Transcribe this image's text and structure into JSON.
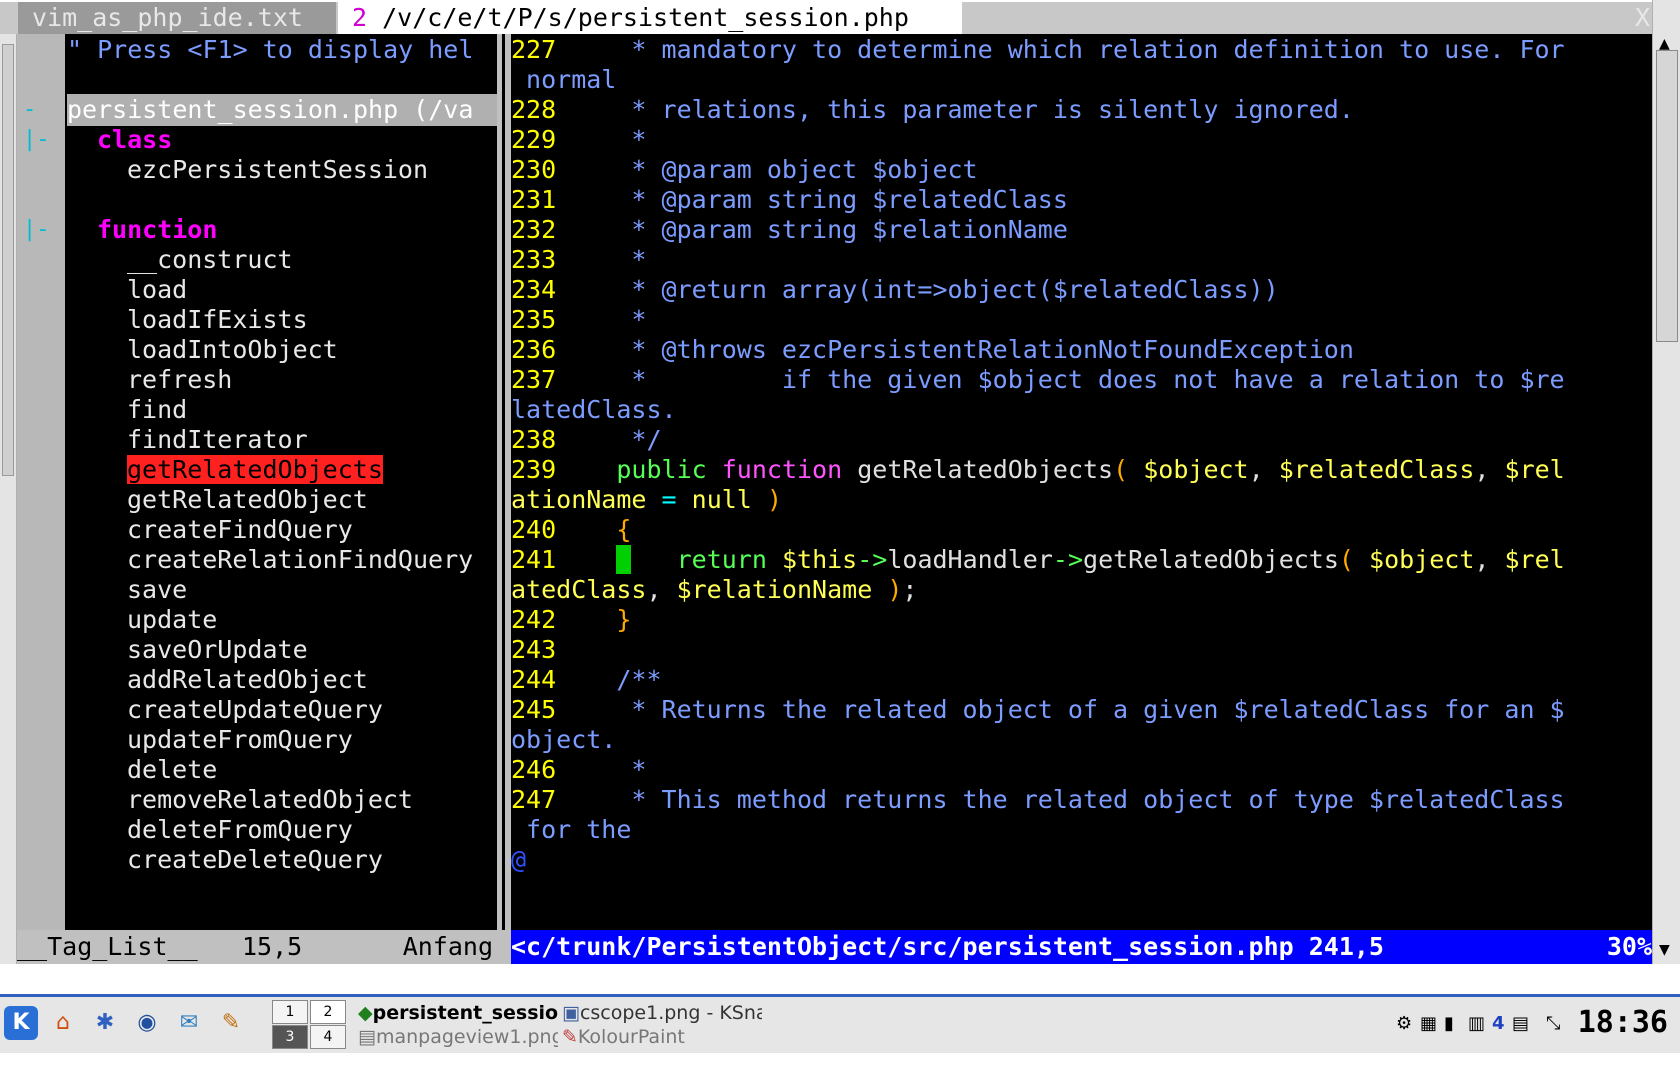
{
  "tabs": [
    {
      "label": "vim_as_php_ide.txt"
    },
    {
      "number": "2",
      "label": " /v/c/e/t/P/s/persistent_session.php"
    }
  ],
  "tab_close": "X",
  "taglist": {
    "help": "\" Press <F1> to display hel",
    "fold_open": "-",
    "file": "persistent_session.php (/va",
    "class_label": "class",
    "class_name": "ezcPersistentSession",
    "function_label": "function",
    "functions": [
      "__construct",
      "load",
      "loadIfExists",
      "loadIntoObject",
      "refresh",
      "find",
      "findIterator",
      "getRelatedObjects",
      "getRelatedObject",
      "createFindQuery",
      "createRelationFindQuery",
      "save",
      "update",
      "saveOrUpdate",
      "addRelatedObject",
      "createUpdateQuery",
      "updateFromQuery",
      "delete",
      "removeRelatedObject",
      "deleteFromQuery",
      "createDeleteQuery"
    ],
    "selected": "getRelatedObjects"
  },
  "code": {
    "l227": "227",
    "t227a": "     * mandatory to determine which relation definition to use. For",
    "t227b": " normal",
    "l228": "228",
    "t228": "     * relations, this parameter is silently ignored.",
    "l229": "229",
    "t229": "     *",
    "l230": "230",
    "t230": "     * @param object $object",
    "l231": "231",
    "t231": "     * @param string $relatedClass",
    "l232": "232",
    "t232": "     * @param string $relationName",
    "l233": "233",
    "t233": "     *",
    "l234": "234",
    "t234": "     * @return array(int=>object($relatedClass))",
    "l235": "235",
    "t235": "     *",
    "l236": "236",
    "t236": "     * @throws ezcPersistentRelationNotFoundException",
    "l237": "237",
    "t237a": "     *         if the given $object does not have a relation to $re",
    "t237b": "latedClass.",
    "l238": "238",
    "t238": "     */",
    "l239": "239",
    "s239_public": "public",
    "s239_function": "function",
    "s239_name": "getRelatedObjects",
    "s239_paren": "(",
    "s239_v1": "$object",
    "s239_comma": ",",
    "s239_v2": "$relatedClass",
    "s239_v3a": "$rel",
    "s239_v3b": "ationName",
    "s239_eq": "=",
    "s239_null": "null",
    "s239_close": ")",
    "l240": "240",
    "s240": "{",
    "l241": "241",
    "s241_return": "return",
    "s241_this": "$this",
    "s241_arrow1": "->",
    "s241_handler": "loadHandler",
    "s241_arrow2": "->",
    "s241_call": "getRelatedObjects",
    "s241_paren": "(",
    "s241_v1": "$object",
    "s241_v2a": "$rel",
    "s241_v2b": "atedClass",
    "s241_v3": "$relationName",
    "s241_close": ")",
    "s241_semi": ";",
    "l242": "242",
    "s242": "}",
    "l243": "243",
    "l244": "244",
    "t244": "    /**",
    "l245": "245",
    "t245a": "     * Returns the related object of a given $relatedClass for an $",
    "t245b": "object.",
    "l246": "246",
    "t246": "     *",
    "l247": "247",
    "t247a": "     * This method returns the related object of type $relatedClass",
    "t247b": " for the",
    "at": "@"
  },
  "status_left": {
    "name": "__Tag_List__",
    "pos": "15,5",
    "where": "Anfang"
  },
  "status_right": {
    "path": "<c/trunk/PersistentObject/src/persistent_session.php 241,5",
    "percent": "30%"
  },
  "taskbar": {
    "pager_1": "1",
    "pager_2": "2",
    "pager_3": "3",
    "pager_4": "4",
    "task1": "persistent_sessio",
    "task2": "cscope1.png - KSna",
    "task3": "manpageview1.png",
    "task4": "KolourPaint",
    "tray_num": "4",
    "clock": "18:36"
  },
  "colors": {
    "background": "#000000",
    "comment": "#7c9cff",
    "line_number": "#ffff00",
    "keyword": "#55ff55",
    "status_bar": "#0000ff",
    "highlight": "#ff2020"
  }
}
